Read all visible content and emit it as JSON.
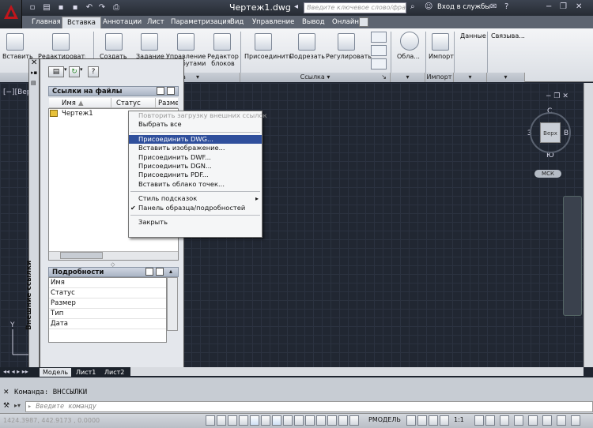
{
  "app": {
    "title": "Чертеж1.dwg",
    "search_placeholder": "Введите ключевое слово/фразу",
    "login": "Вход в службы"
  },
  "tabs": [
    "Главная",
    "Вставка",
    "Аннотации",
    "Лист",
    "Параметризация",
    "Вид",
    "Управление",
    "Вывод",
    "Онлайн"
  ],
  "active_tab": "Вставка",
  "ribbon": {
    "left_buttons": [
      "Вставить",
      "Редактировать атрибут",
      "Создать",
      "Задание",
      "Управление атрибутами",
      "Редактор блоков"
    ],
    "left_panel_footer": "а",
    "link_buttons": [
      "Присоединить",
      "Подрезать",
      "Регулировать"
    ],
    "link_panel": "Ссылка",
    "cloud_button": "Обла...",
    "import_button": "Импорт",
    "import_panel": "Импорт",
    "data_panel": "Данные",
    "link_panel2": "Связыва..."
  },
  "viewport": {
    "label": "[−][Вер"
  },
  "palette": {
    "title_vertical": "Внешние ссылки",
    "section_files": "Ссылки на файлы",
    "columns": [
      "Имя",
      "Статус",
      "Размер"
    ],
    "files": [
      {
        "name": "Чертеж1"
      }
    ],
    "section_details": "Подробности",
    "details_rows": [
      "Имя",
      "Статус",
      "Размер",
      "Тип",
      "Дата"
    ]
  },
  "context_menu": {
    "items": [
      {
        "label": "Повторить загрузку внешних ссылок",
        "state": "disabled"
      },
      {
        "label": "Выбрать все",
        "state": "normal"
      },
      {
        "sep": true
      },
      {
        "label": "Присоединить DWG...",
        "state": "highlight"
      },
      {
        "label": "Вставить изображение...",
        "state": "normal"
      },
      {
        "label": "Присоединить DWF...",
        "state": "normal"
      },
      {
        "label": "Присоединить DGN...",
        "state": "normal"
      },
      {
        "label": "Присоединить PDF...",
        "state": "normal"
      },
      {
        "label": "Вставить облако точек...",
        "state": "normal"
      },
      {
        "sep": true
      },
      {
        "label": "Стиль подсказок",
        "state": "submenu"
      },
      {
        "label": "Панель образца/подробностей",
        "state": "checked"
      },
      {
        "sep": true
      },
      {
        "label": "Закрыть",
        "state": "normal"
      }
    ]
  },
  "viewcube": {
    "top": "С",
    "left": "З",
    "right": "В",
    "bottom": "Ю",
    "face": "Верх",
    "wcs": "МСК"
  },
  "layout_tabs": [
    "Модель",
    "Лист1",
    "Лист2"
  ],
  "command": {
    "history": "Команда: ВНССЫЛКИ",
    "placeholder": "Введите команду"
  },
  "status": {
    "coords": "1424.3987, 442.9173 , 0.0000",
    "model": "РМОДЕЛЬ",
    "scale": "1:1"
  },
  "colors": {
    "accent": "#2f4f9c",
    "canvas": "#212732"
  }
}
